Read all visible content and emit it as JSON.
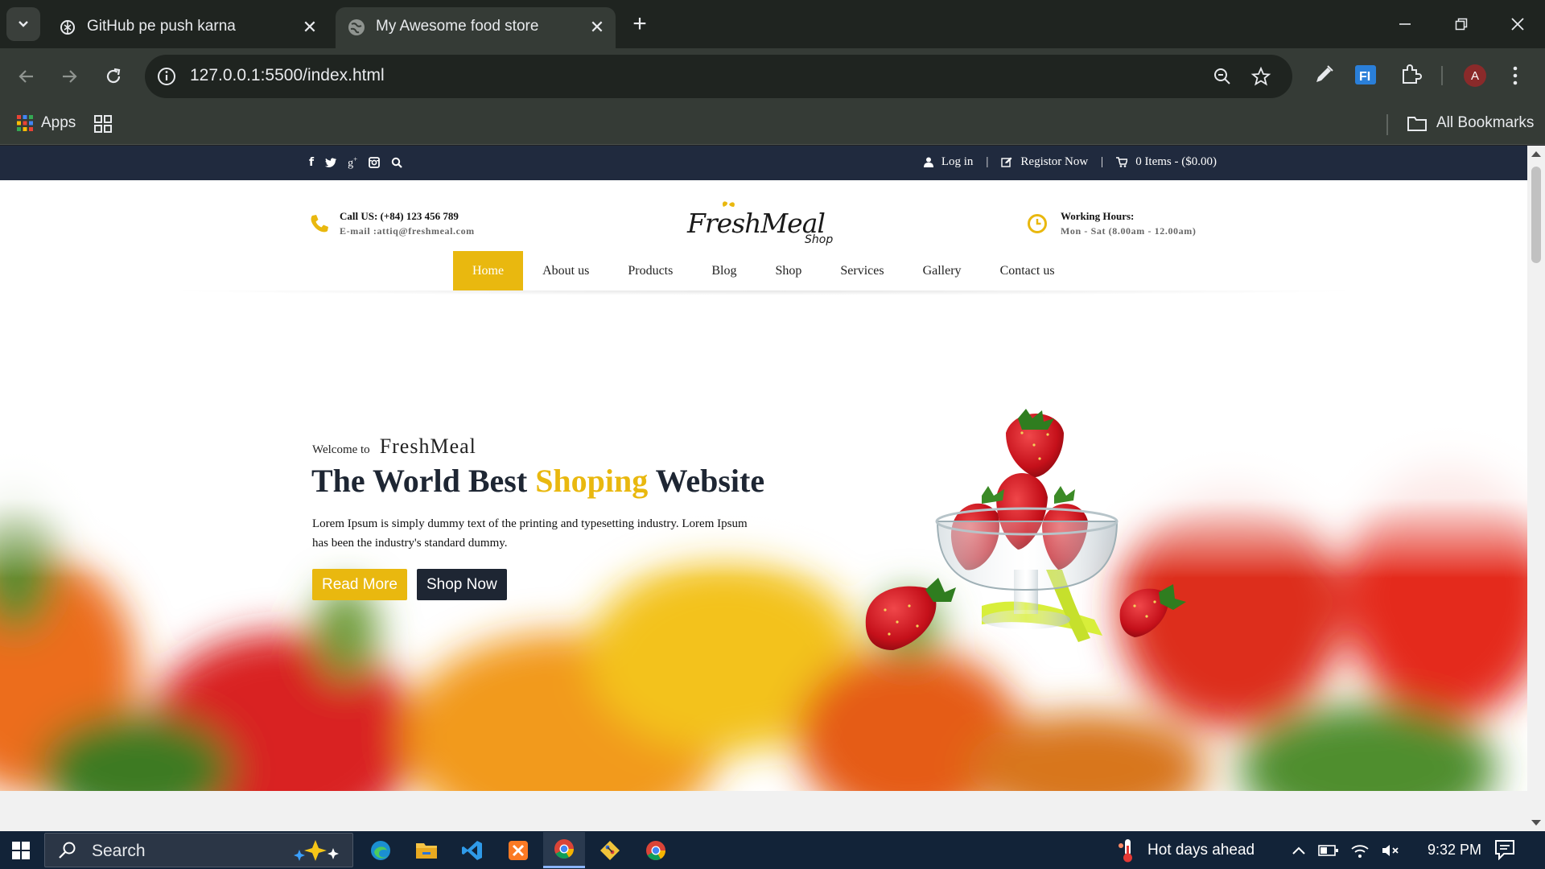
{
  "browser": {
    "tabs": [
      {
        "title": "GitHub pe push karna",
        "favicon": "openai-icon"
      },
      {
        "title": "My Awesome food store",
        "favicon": "globe-icon"
      }
    ],
    "url": "127.0.0.1:5500/index.html",
    "bookmarks": {
      "apps_label": "Apps",
      "all_bookmarks_label": "All Bookmarks"
    },
    "profile_initial": "A"
  },
  "site": {
    "topbar": {
      "social_icons": [
        "facebook-icon",
        "twitter-icon",
        "google-plus-icon",
        "instagram-icon",
        "search-icon"
      ],
      "login": "Log in",
      "separator": "|",
      "register": "Registor Now",
      "cart": "0 Items - ($0.00)"
    },
    "contact": {
      "line1": "Call US: (+84) 123 456 789",
      "line2": "E-mail :attiq@freshmeal.com"
    },
    "hours": {
      "line1": "Working Hours:",
      "line2": "Mon - Sat (8.00am - 12.00am)"
    },
    "logo": {
      "name": "FreshMeal",
      "sub": "Shop"
    },
    "menu": [
      "Home",
      "About us",
      "Products",
      "Blog",
      "Shop",
      "Services",
      "Gallery",
      "Contact us"
    ],
    "menu_active": "Home",
    "hero": {
      "welcome": "Welcome to",
      "brand": "FreshMeal",
      "headline_a": "The World Best ",
      "headline_b": "Shoping",
      "headline_c": " Website",
      "description": "Lorem Ipsum is simply dummy text of the printing and typesetting industry. Lorem Ipsum has been the industry's standard dummy.",
      "read_more": "Read More",
      "shop_now": "Shop Now"
    },
    "colors": {
      "accent": "#e9b80f",
      "dark": "#1e2633",
      "topbar": "#202a3e"
    }
  },
  "taskbar": {
    "search_placeholder": "Search",
    "weather": "Hot days ahead",
    "time": "9:32 PM",
    "apps": [
      "edge-icon",
      "file-explorer-icon",
      "vscode-icon",
      "xampp-icon",
      "chrome-icon",
      "git-icon",
      "chrome-icon"
    ]
  }
}
